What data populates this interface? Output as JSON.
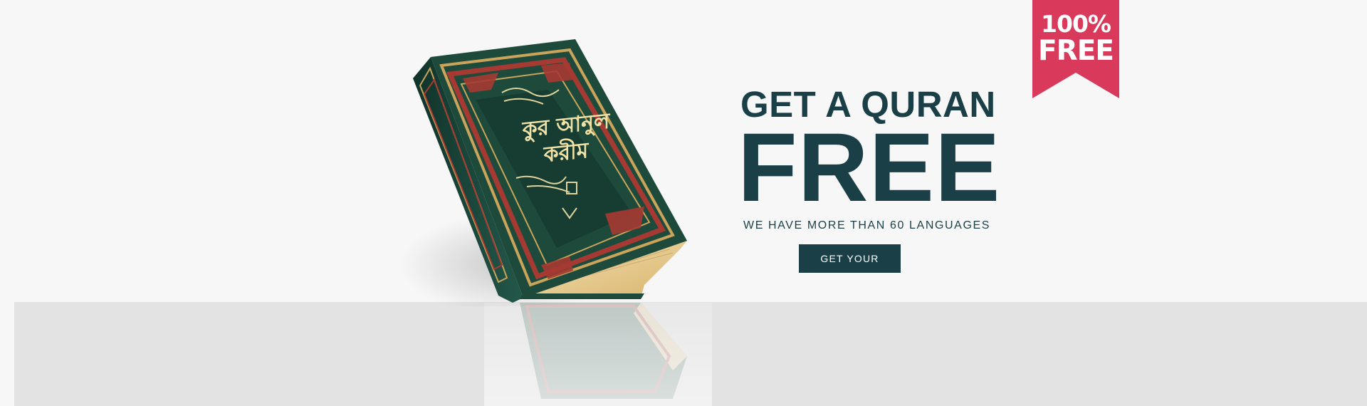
{
  "banner": {
    "headline_line1": "GET A QURAN",
    "headline_line2": "FREE",
    "subheadline": "WE HAVE MORE THAN 60 LANGUAGES",
    "cta_label": "GET YOUR"
  },
  "ribbon": {
    "line1": "100%",
    "line2": "FREE"
  },
  "book": {
    "cover_title_line1": "কুর আনুল",
    "cover_title_line2": "করীম"
  },
  "colors": {
    "brand_dark": "#1b3f47",
    "ribbon": "#d9395a",
    "background": "#f7f7f7",
    "floor": "#e3e3e3",
    "book_cover": "#1e4a3c",
    "book_pages": "#e7c98f",
    "book_gold": "#c9a45a",
    "book_red": "#a63a32"
  }
}
